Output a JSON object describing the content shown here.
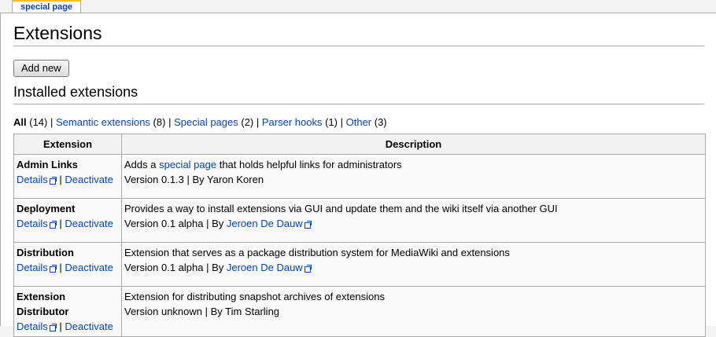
{
  "tab": {
    "label": "special page"
  },
  "page_title": "Extensions",
  "add_new_label": "Add new",
  "section_title": "Installed extensions",
  "filters": {
    "all_label": "All",
    "all_count": " (14) ",
    "semantic_label": "Semantic extensions",
    "semantic_count": " (8) ",
    "special_label": "Special pages",
    "special_count": " (2) ",
    "parser_label": "Parser hooks",
    "parser_count": " (1) ",
    "other_label": "Other",
    "other_count": " (3)",
    "separator": "|"
  },
  "table": {
    "col_extension": "Extension",
    "col_description": "Description",
    "details_label": "Details",
    "deactivate_label": "Deactivate",
    "rows": [
      {
        "name": "Admin Links",
        "desc_before": "Adds a ",
        "desc_link": "special page",
        "desc_after": " that holds helpful links for administrators",
        "version_line": "Version 0.1.3 | By Yaron Koren",
        "author_link": ""
      },
      {
        "name": "Deployment",
        "desc_before": "Provides a way to install extensions via GUI and update them and the wiki itself via another GUI",
        "desc_link": "",
        "desc_after": "",
        "version_line": "Version 0.1 alpha | By ",
        "author_link": "Jeroen De Dauw"
      },
      {
        "name": "Distribution",
        "desc_before": "Extension that serves as a package distribution system for MediaWiki and extensions",
        "desc_link": "",
        "desc_after": "",
        "version_line": "Version 0.1 alpha | By ",
        "author_link": "Jeroen De Dauw"
      },
      {
        "name": "Extension Distributor",
        "desc_before": "Extension for distributing snapshot archives of extensions",
        "desc_link": "",
        "desc_after": "",
        "version_line": "Version unknown | By Tim Starling",
        "author_link": ""
      }
    ]
  },
  "colors": {
    "link": "#0645ad",
    "tab_accent": "#fabd23",
    "border": "#aaaaaa"
  },
  "icons": {
    "external_link": "external-link-icon"
  }
}
